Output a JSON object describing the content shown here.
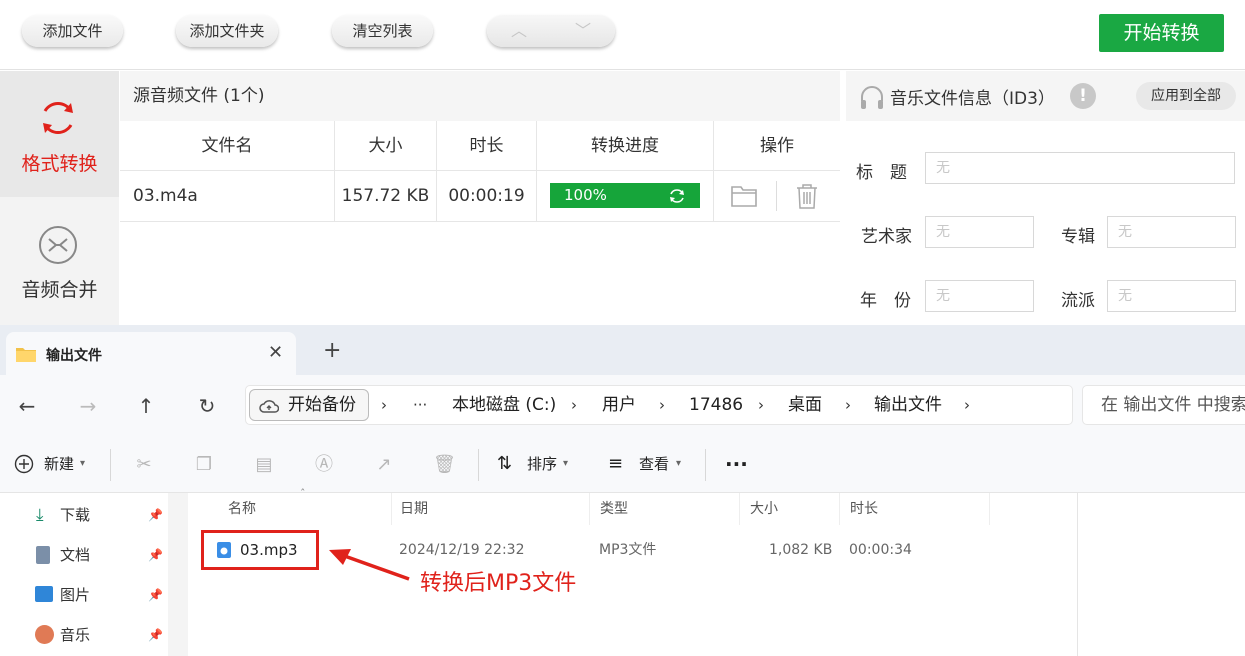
{
  "converter": {
    "toolbar": {
      "add_file": "添加文件",
      "add_folder": "添加文件夹",
      "clear_list": "清空列表",
      "start": "开始转换"
    },
    "sidebar": [
      {
        "label": "格式转换",
        "active": true
      },
      {
        "label": "音频合并",
        "active": false
      }
    ],
    "list": {
      "title": "源音频文件 (1个)",
      "columns": [
        "文件名",
        "大小",
        "时长",
        "转换进度",
        "操作"
      ],
      "rows": [
        {
          "name": "03.m4a",
          "size": "157.72 KB",
          "duration": "00:00:19",
          "progress": "100%"
        }
      ]
    },
    "info": {
      "title": "音乐文件信息（ID3）",
      "apply_all": "应用到全部",
      "fields": {
        "title_label": "标　题",
        "artist_label": "艺术家",
        "album_label": "专辑",
        "year_label": "年　份",
        "genre_label": "流派",
        "empty_value": "无"
      }
    },
    "accent_color": "#1aa843",
    "active_color": "#e0221b"
  },
  "explorer": {
    "tab_title": "输出文件",
    "breadcrumb": [
      "开始备份",
      "本地磁盘 (C:)",
      "用户",
      "17486",
      "桌面",
      "输出文件"
    ],
    "search_placeholder": "在 输出文件 中搜索",
    "commands": {
      "new": "新建",
      "sort": "排序",
      "view": "查看"
    },
    "nav_items": [
      "下载",
      "文档",
      "图片",
      "音乐"
    ],
    "columns": [
      "名称",
      "日期",
      "类型",
      "大小",
      "时长"
    ],
    "files": [
      {
        "name": "03.mp3",
        "date": "2024/12/19 22:32",
        "type": "MP3文件",
        "size": "1,082 KB",
        "duration": "00:00:34"
      }
    ]
  },
  "annotation": {
    "text": "转换后MP3文件",
    "color": "#e0221b"
  }
}
